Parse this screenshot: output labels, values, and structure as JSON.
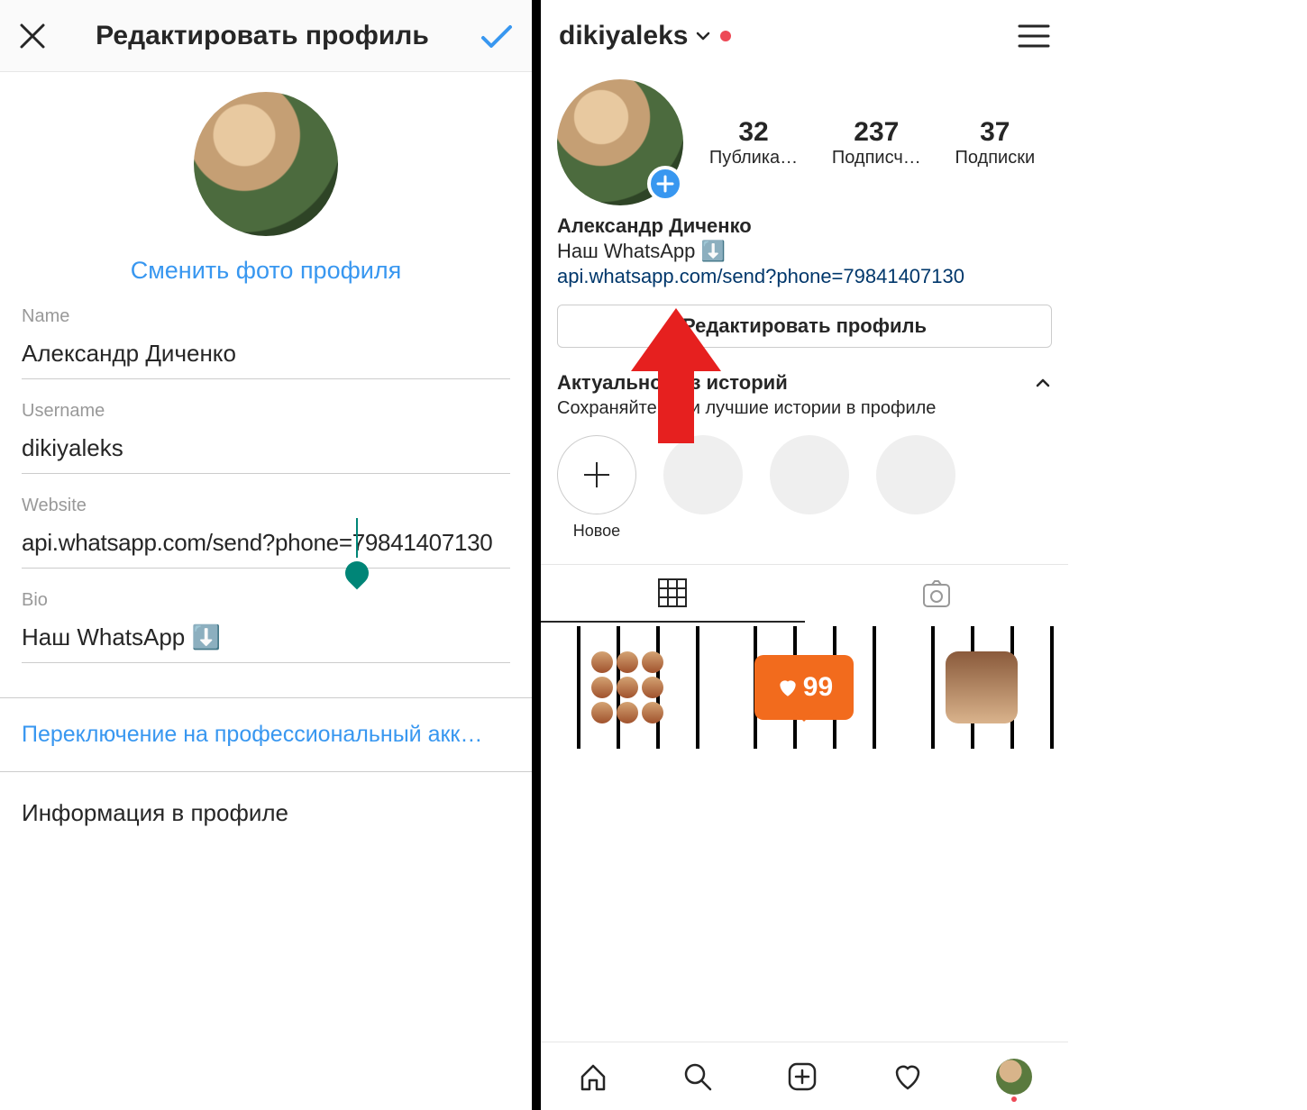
{
  "edit": {
    "title": "Редактировать профиль",
    "change_photo": "Сменить фото профиля",
    "fields": {
      "name_label": "Name",
      "name_value": "Александр Диченко",
      "username_label": "Username",
      "username_value": "dikiyaleks",
      "website_label": "Website",
      "website_value": "api.whatsapp.com/send?phone=79841407130",
      "bio_label": "Bio",
      "bio_value": "Наш WhatsApp ⬇️"
    },
    "switch_pro": "Переключение на профессиональный акк…",
    "profile_info_section": "Информация в профиле"
  },
  "profile": {
    "username": "dikiyaleks",
    "stats": {
      "posts_num": "32",
      "posts_label": "Публика…",
      "followers_num": "237",
      "followers_label": "Подписч…",
      "following_num": "37",
      "following_label": "Подписки"
    },
    "display_name": "Александр Диченко",
    "bio_text": "Наш WhatsApp ⬇️",
    "bio_link": "api.whatsapp.com/send?phone=79841407130",
    "edit_button": "Редактировать профиль",
    "highlights_title": "Актуальное из историй",
    "highlights_sub": "Сохраняйте свои лучшие истории в профиле",
    "highlight_new": "Новое",
    "feed_like_count": "99"
  }
}
